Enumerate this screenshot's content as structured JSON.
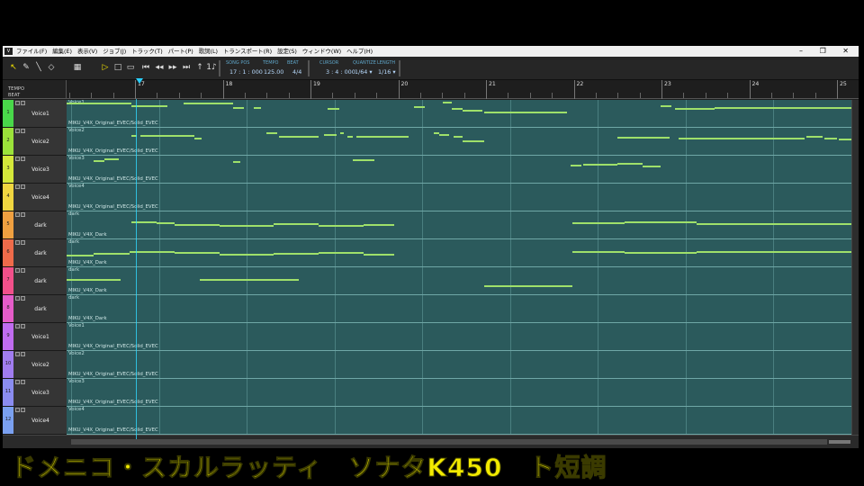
{
  "menubar": {
    "logo": "V",
    "items": [
      "ファイル(F)",
      "編集(E)",
      "表示(V)",
      "ジョブ(J)",
      "トラック(T)",
      "パート(P)",
      "歌詞(L)",
      "トランスポート(R)",
      "設定(S)",
      "ウィンドウ(W)",
      "ヘルプ(H)"
    ],
    "controls": "– ❐ ✕"
  },
  "toolbar": {
    "tools": [
      "arrow-tool-icon",
      "pencil-tool-icon",
      "line-tool-icon",
      "eraser-tool-icon",
      "grid-icon",
      "play-icon",
      "stop-icon",
      "loop-icon",
      "rewind-start-icon",
      "rewind-icon",
      "forward-icon",
      "forward-end-icon",
      "record-icon",
      "metronome-icon"
    ],
    "tool_glyphs": [
      "↖",
      "✎",
      "╲",
      "◇",
      "▦",
      "▷",
      "□",
      "▭",
      "⏮",
      "◂◂",
      "▸▸",
      "⏭",
      "↑",
      "1♪"
    ],
    "song_pos_label": "SONG POS",
    "song_pos": "17 : 1 : 000",
    "tempo_label": "TEMPO",
    "tempo": "125.00",
    "beat_label": "BEAT",
    "beat": "4/4",
    "cursor_label": "CURSOR",
    "cursor": "3 : 4 : 000",
    "quantize_label": "QUANTIZE",
    "quantize": "1/64 ▾",
    "length_label": "LENGTH",
    "length": "1/16 ▾"
  },
  "ruler": {
    "tempo_label": "TEMPO",
    "beat_label": "BEAT",
    "bars": [
      "17",
      "18",
      "19",
      "20",
      "21",
      "22",
      "23",
      "24",
      "25"
    ]
  },
  "tracks": [
    {
      "num": "1",
      "name": "Voice1",
      "part": "Voice1",
      "singer": "MIKU_V4X_Original_EVEC/Solid_EVEC",
      "color": "#49d84a"
    },
    {
      "num": "2",
      "name": "Voice2",
      "part": "Voice2",
      "singer": "MIKU_V4X_Original_EVEC/Solid_EVEC",
      "color": "#9be23a"
    },
    {
      "num": "3",
      "name": "Voice3",
      "part": "Voice3",
      "singer": "MIKU_V4X_Original_EVEC/Solid_EVEC",
      "color": "#d4e83a"
    },
    {
      "num": "4",
      "name": "Voice4",
      "part": "Voice4",
      "singer": "MIKU_V4X_Original_EVEC/Solid_EVEC",
      "color": "#f0d640"
    },
    {
      "num": "5",
      "name": "dark",
      "part": "dark",
      "singer": "MIKU_V4X_Dark",
      "color": "#f0a040"
    },
    {
      "num": "6",
      "name": "dark",
      "part": "dark",
      "singer": "MIKU_V4X_Dark",
      "color": "#ef6b4a"
    },
    {
      "num": "7",
      "name": "dark",
      "part": "dark",
      "singer": "MIKU_V4X_Dark",
      "color": "#f2508a"
    },
    {
      "num": "8",
      "name": "dark",
      "part": "dark",
      "singer": "MIKU_V4X_Dark",
      "color": "#e55cc8"
    },
    {
      "num": "9",
      "name": "Voice1",
      "part": "Voice1",
      "singer": "MIKU_V4X_Original_EVEC/Solid_EVEC",
      "color": "#c06cf0"
    },
    {
      "num": "10",
      "name": "Voice2",
      "part": "Voice2",
      "singer": "MIKU_V4X_Original_EVEC/Solid_EVEC",
      "color": "#a07cf0"
    },
    {
      "num": "11",
      "name": "Voice3",
      "part": "Voice3",
      "singer": "MIKU_V4X_Original_EVEC/Solid_EVEC",
      "color": "#8a8cf0"
    },
    {
      "num": "12",
      "name": "Voice4",
      "part": "Voice4",
      "singer": "MIKU_V4X_Original_EVEC/Solid_EVEC",
      "color": "#7aa0f0"
    }
  ],
  "caption": "ドメニコ・スカルラッティ　ソナタK450　ト短調",
  "colors": {
    "lane": "#2b5a5c",
    "note": "#9fe06a",
    "playhead": "#2fd8ff",
    "caption": "#f2ea00"
  }
}
